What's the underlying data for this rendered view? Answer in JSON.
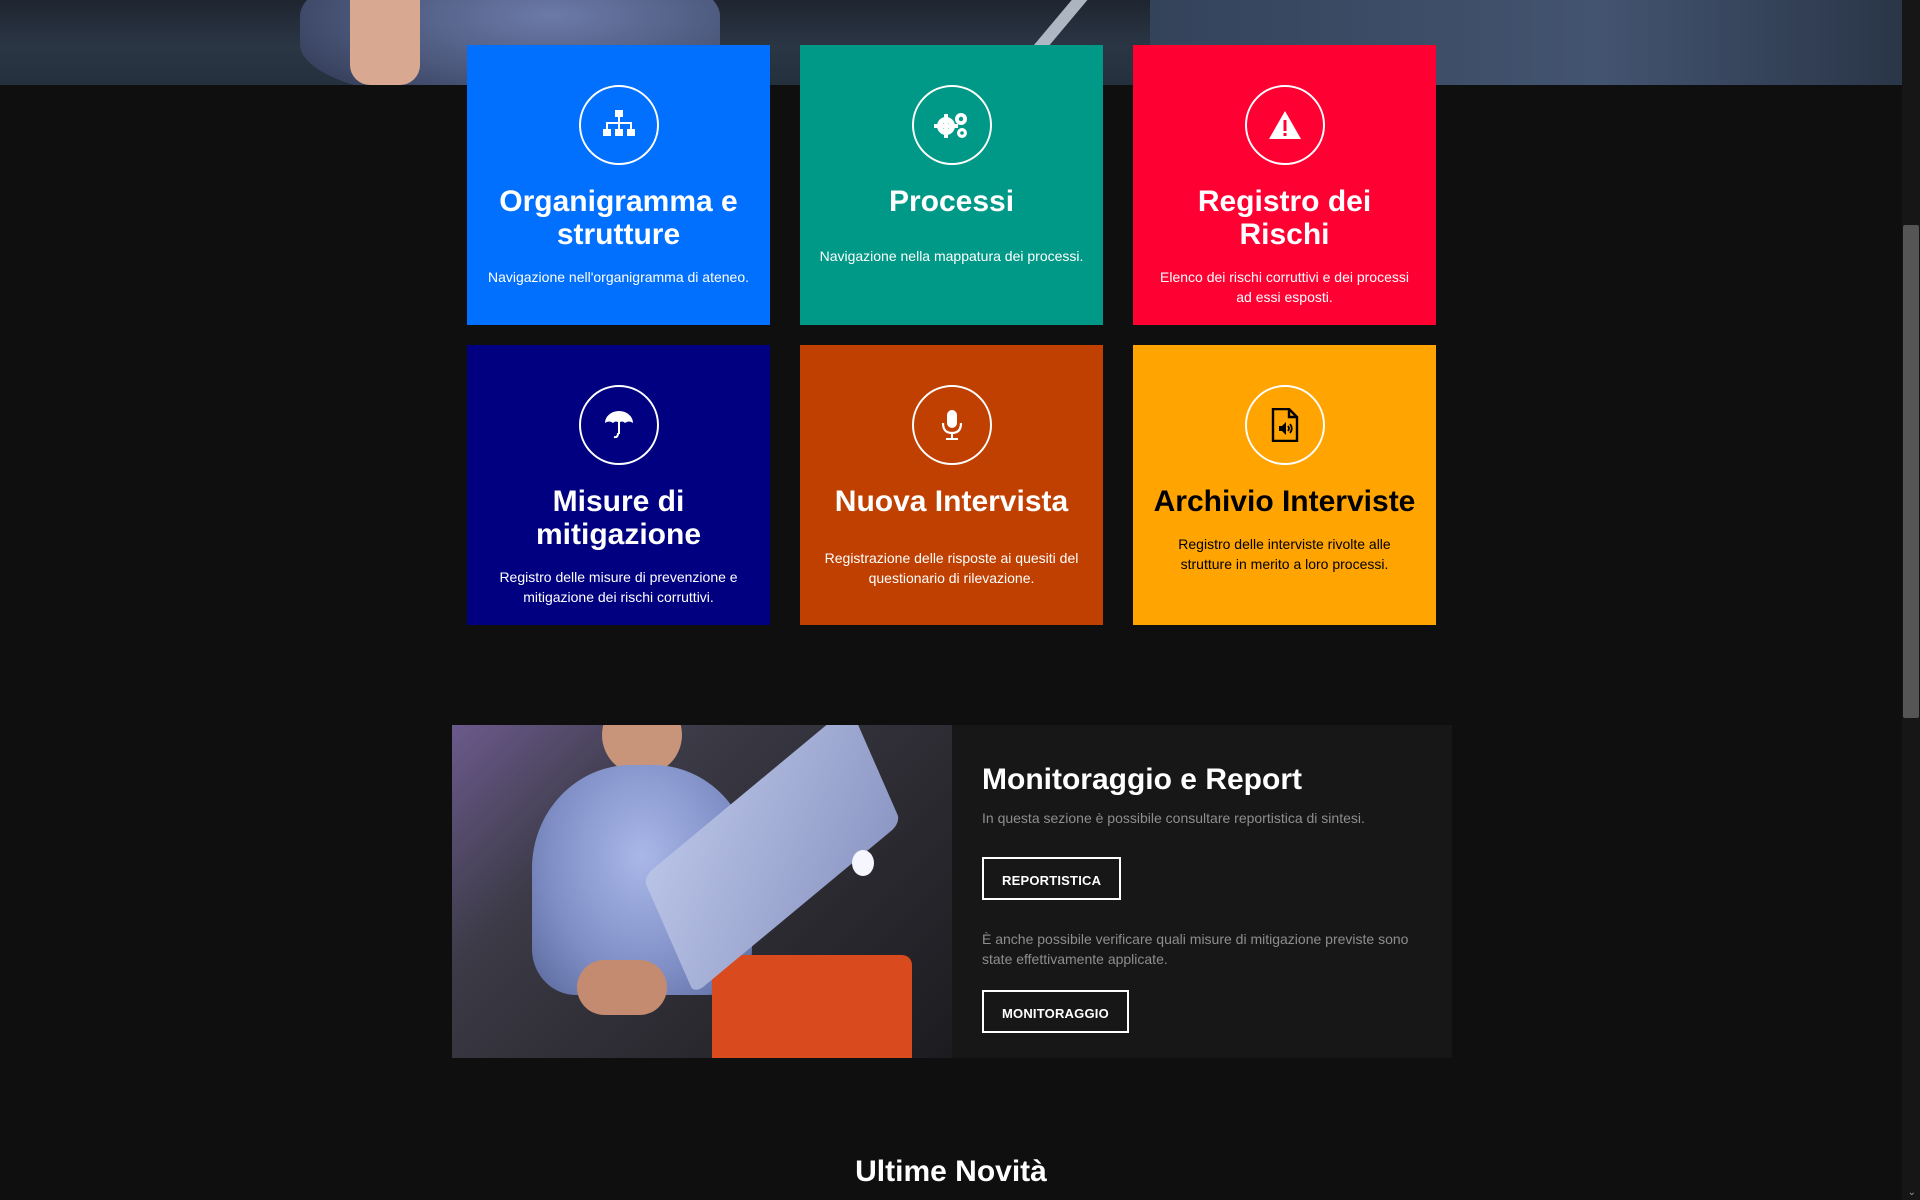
{
  "tiles": [
    {
      "icon": "sitemap-icon",
      "title": "Organigramma e strutture",
      "description": "Navigazione nell'organigramma di ateneo.",
      "color": "#0170fe",
      "text_color": "#ffffff"
    },
    {
      "icon": "gears-icon",
      "title": "Processi",
      "description": "Navigazione nella mappatura dei processi.",
      "color": "#009886",
      "text_color": "#ffffff"
    },
    {
      "icon": "warning-icon",
      "title": "Registro dei Rischi",
      "description": "Elenco dei rischi corruttivi e dei processi ad essi esposti.",
      "color": "#ff0033",
      "text_color": "#ffffff"
    },
    {
      "icon": "umbrella-icon",
      "title": "Misure di mitigazione",
      "description": "Registro delle misure di prevenzione e mitigazione dei rischi corruttivi.",
      "color": "#000080",
      "text_color": "#ffffff"
    },
    {
      "icon": "microphone-icon",
      "title": "Nuova Intervista",
      "description": "Registrazione delle risposte ai quesiti del questionario di rilevazione.",
      "color": "#bf4000",
      "text_color": "#ffffff"
    },
    {
      "icon": "file-audio-icon",
      "title": "Archivio Interviste",
      "description": "Registro delle interviste rivolte alle strutture in merito a loro processi.",
      "color": "#ffa400",
      "text_color": "#000000"
    }
  ],
  "monitor": {
    "title": "Monitoraggio e Report",
    "text1": "In questa sezione è possibile consultare reportistica di sintesi.",
    "button1": "REPORTISTICA",
    "text2": "È anche possibile verificare quali misure di mitigazione previste sono state effettivamente applicate.",
    "button2": "MONITORAGGIO"
  },
  "news": {
    "title": "Ultime Novità"
  }
}
